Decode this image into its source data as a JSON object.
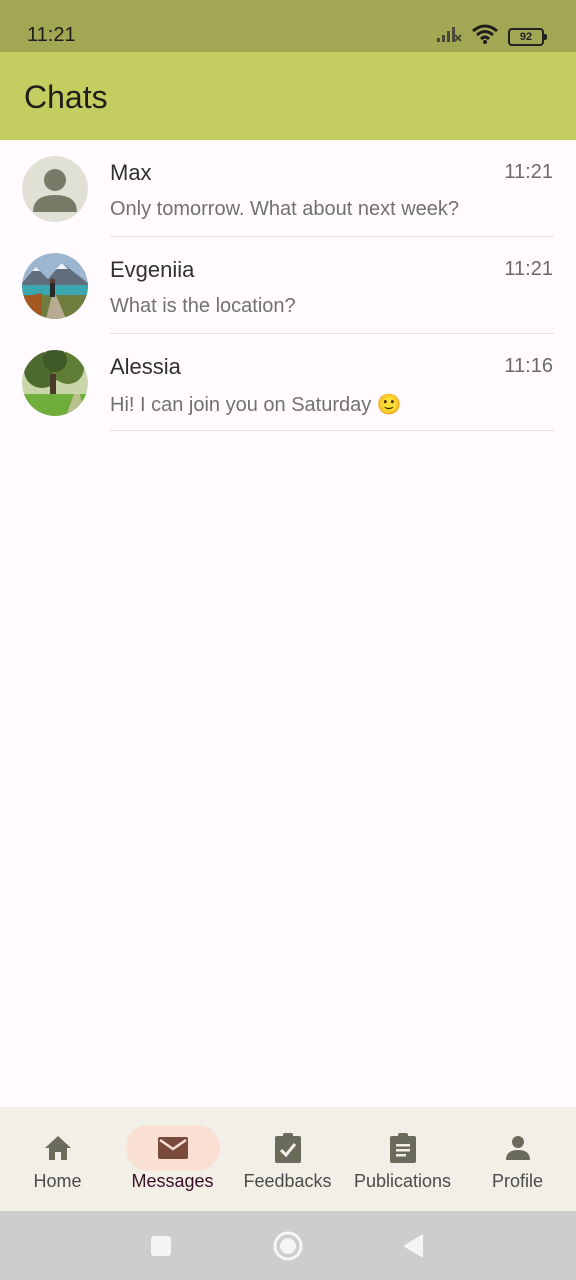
{
  "status_bar": {
    "time": "11:21",
    "battery": "92",
    "icons": [
      "signal-icon",
      "wifi-icon",
      "battery-icon"
    ]
  },
  "app_bar": {
    "title": "Chats"
  },
  "chats": [
    {
      "name": "Max",
      "time": "11:21",
      "preview": "Only tomorrow. What about next week?",
      "avatar": "default-person-avatar"
    },
    {
      "name": "Evgeniia",
      "time": "11:21",
      "preview": "What is the location?",
      "avatar": "mountain-lake-photo"
    },
    {
      "name": "Alessia",
      "time": "11:16",
      "preview": "Hi! I can join you on Saturday 🙂",
      "avatar": "park-tree-photo"
    }
  ],
  "bottom_nav": {
    "items": [
      {
        "label": "Home",
        "icon": "home-icon",
        "active": false
      },
      {
        "label": "Messages",
        "icon": "mail-icon",
        "active": true
      },
      {
        "label": "Feedbacks",
        "icon": "clipboard-check-icon",
        "active": false
      },
      {
        "label": "Publications",
        "icon": "clipboard-text-icon",
        "active": false
      },
      {
        "label": "Profile",
        "icon": "person-icon",
        "active": false
      }
    ]
  },
  "system_nav": {
    "icons": [
      "recent-apps-icon",
      "home-circle-icon",
      "back-icon"
    ]
  },
  "colors": {
    "status_bar": "#a1a752",
    "app_bar": "#c4cd5f",
    "active_pill": "#fadfd3",
    "background": "#fffbfe"
  }
}
